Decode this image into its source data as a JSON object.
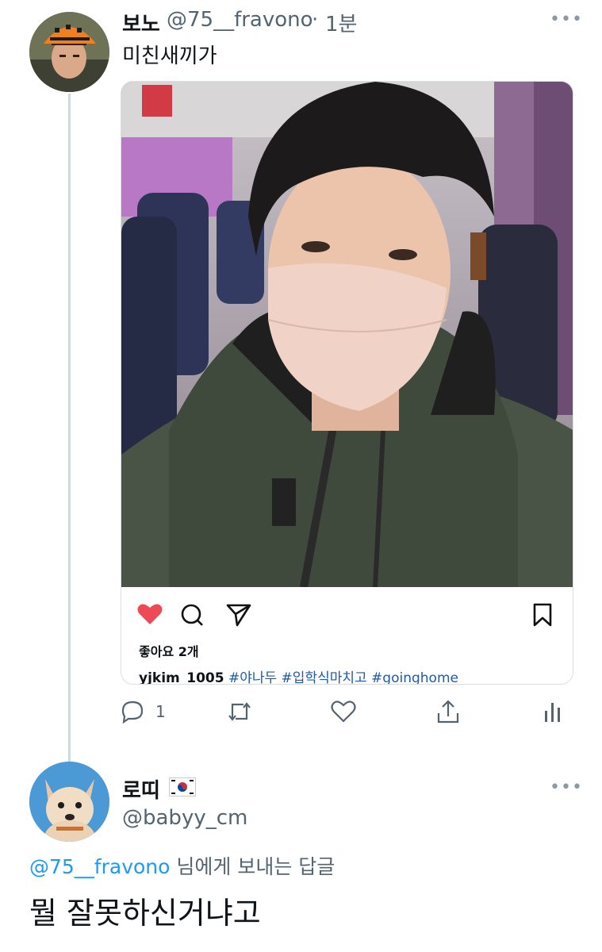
{
  "tweet": {
    "display_name": "보노",
    "handle": "@75__fravono",
    "separator": "·",
    "time": "1분",
    "text": "미친새끼가",
    "more_icon": "more-icon"
  },
  "embedded_post": {
    "photo_icon": "selfie-photo",
    "like_icon": "heart-filled-icon",
    "like_color": "#ed4956",
    "likes_text": "좋아요 2개",
    "username": "yjkim_1005",
    "hashtags": "#야나두 #입학식마치고 #goinghome",
    "hashtag_color": "#1d5aa8"
  },
  "tweet_actions": {
    "reply_count": "1",
    "icons": [
      "reply-icon",
      "retweet-icon",
      "like-icon",
      "share-icon",
      "analytics-icon"
    ]
  },
  "reply": {
    "display_name": "로띠",
    "flag": "south-korea-flag-icon",
    "handle": "@babyy_cm",
    "reply_mention": "@75__fravono",
    "reply_suffix": " 님에게 보내는 답글",
    "text": "뭘 잘못하신거냐고"
  },
  "colors": {
    "mention": "#1d9bf0",
    "secondary_text": "#536471",
    "thread_line": "#cfd9de"
  }
}
